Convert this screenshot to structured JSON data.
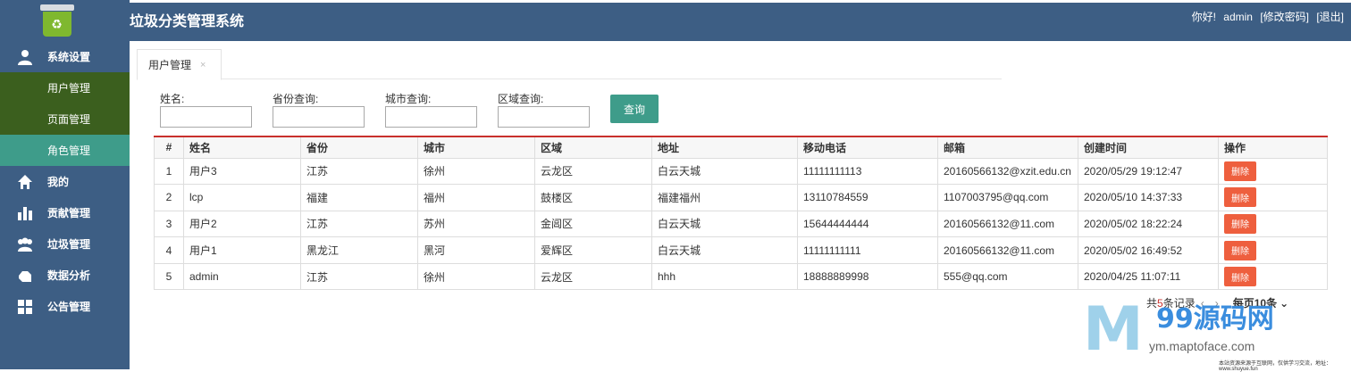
{
  "header": {
    "title": "垃圾分类管理系统",
    "greeting": "你好!",
    "username": "admin",
    "change_password": "[修改密码]",
    "logout": "[退出]"
  },
  "sidebar": {
    "logo_glyph": "♻",
    "items": [
      {
        "label": "系统设置",
        "icon": "user-icon"
      },
      {
        "label": "我的",
        "icon": "home-icon"
      },
      {
        "label": "贡献管理",
        "icon": "bar-chart-icon"
      },
      {
        "label": "垃圾管理",
        "icon": "group-icon"
      },
      {
        "label": "数据分析",
        "icon": "hand-icon"
      },
      {
        "label": "公告管理",
        "icon": "grid-icon"
      }
    ],
    "sub_items": [
      {
        "label": "用户管理"
      },
      {
        "label": "页面管理"
      },
      {
        "label": "角色管理",
        "active": true
      }
    ]
  },
  "tabs": [
    {
      "label": "用户管理",
      "close": "×"
    }
  ],
  "filters": {
    "name_label": "姓名:",
    "province_label": "省份查询:",
    "city_label": "城市查询:",
    "area_label": "区域查询:",
    "query_button": "查询"
  },
  "table": {
    "headers": [
      "#",
      "姓名",
      "省份",
      "城市",
      "区域",
      "地址",
      "移动电话",
      "邮箱",
      "创建时间",
      "操作"
    ],
    "rows": [
      [
        "1",
        "用户3",
        "江苏",
        "徐州",
        "云龙区",
        "白云天城",
        "11111111113",
        "20160566132@xzit.edu.cn",
        "2020/05/29 19:12:47"
      ],
      [
        "2",
        "lcp",
        "福建",
        "福州",
        "鼓楼区",
        "福建福州",
        "13110784559",
        "1107003795@qq.com",
        "2020/05/10 14:37:33"
      ],
      [
        "3",
        "用户2",
        "江苏",
        "苏州",
        "金阊区",
        "白云天城",
        "15644444444",
        "20160566132@11.com",
        "2020/05/02 18:22:24"
      ],
      [
        "4",
        "用户1",
        "黑龙江",
        "黑河",
        "爱辉区",
        "白云天城",
        "11111111111",
        "20160566132@11.com",
        "2020/05/02 16:49:52"
      ],
      [
        "5",
        "admin",
        "江苏",
        "徐州",
        "云龙区",
        "hhh",
        "18888889998",
        "555@qq.com",
        "2020/04/25 11:07:11"
      ]
    ],
    "delete_label": "删除"
  },
  "pager": {
    "prefix": "共",
    "count": "5",
    "suffix": "条记录",
    "prev": "‹",
    "next": "›",
    "per_page": "每页10条"
  },
  "watermark": {
    "brand": "99源码网",
    "url": "ym.maptoface.com",
    "note": "本站资源来源于互联网，仅供学习交流，地址：www.shuyue.fun"
  },
  "colors": {
    "sidebar_bg": "#3d5e84",
    "submenu_bg": "#3b5f1e",
    "active_bg": "#3e9c8a",
    "delete_button": "#ee5f3e"
  }
}
